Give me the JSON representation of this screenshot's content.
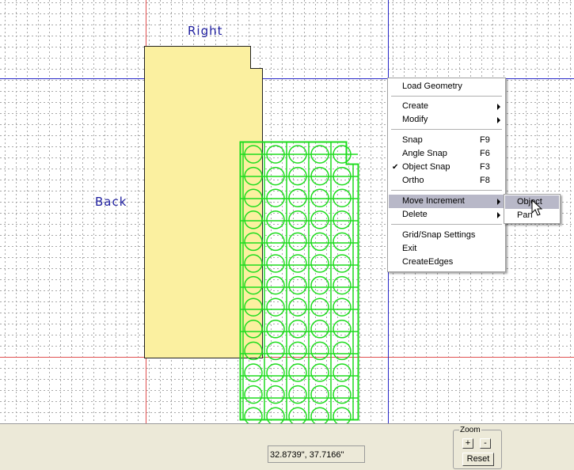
{
  "canvas": {
    "labels": {
      "right": "Right",
      "back": "Back"
    }
  },
  "context_menu": {
    "load_geometry": "Load Geometry",
    "create": "Create",
    "modify": "Modify",
    "snap": {
      "label": "Snap",
      "shortcut": "F9"
    },
    "angle_snap": {
      "label": "Angle Snap",
      "shortcut": "F6"
    },
    "object_snap": {
      "label": "Object Snap",
      "shortcut": "F3",
      "checked": true
    },
    "ortho": {
      "label": "Ortho",
      "shortcut": "F8"
    },
    "move_increment": "Move Increment",
    "delete": "Delete",
    "grid_snap_settings": "Grid/Snap Settings",
    "exit": "Exit",
    "create_edges": "CreateEdges"
  },
  "submenu": {
    "object": "Object",
    "pan": "Pan"
  },
  "status": {
    "coordinates": "32.8739\", 37.7166\""
  },
  "zoom": {
    "legend": "Zoom",
    "zoom_in": "+",
    "zoom_out": "-",
    "reset": "Reset"
  },
  "colors": {
    "grid": "#a8a8a8",
    "axis_blue": "#2828c8",
    "axis_red": "#e05050",
    "yellow_fill": "#fbf0a0",
    "green": "#1edc1e"
  }
}
